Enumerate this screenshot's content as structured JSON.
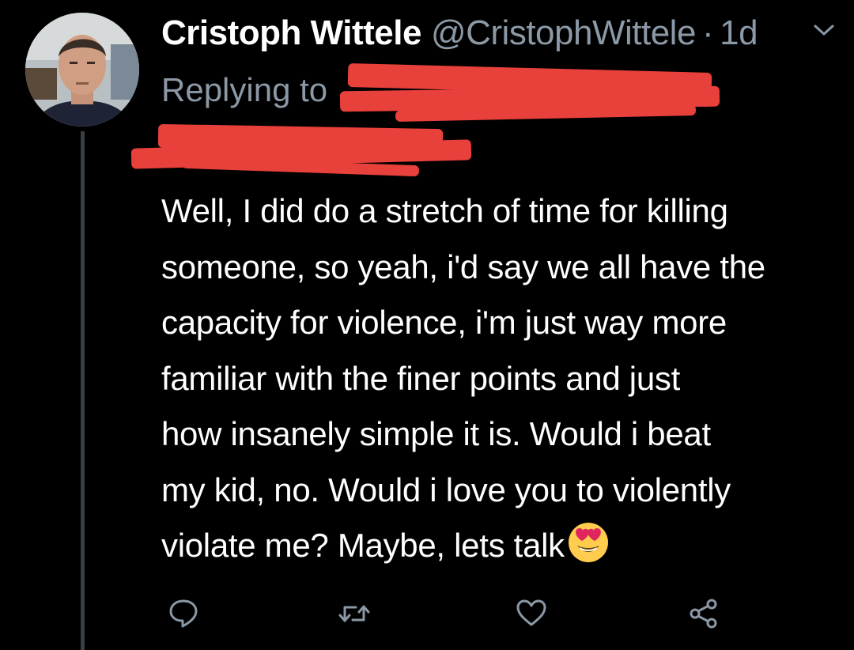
{
  "tweet": {
    "author": {
      "display_name": "Cristoph Wittele",
      "handle": "@CristophWittele",
      "separator": "·",
      "time": "1d"
    },
    "reply": {
      "prefix": "Replying to"
    },
    "body_lines": [
      "Well, I did do a stretch of time for killing",
      "someone, so yeah, i'd say we all have the",
      "capacity for violence, i'm just way more",
      "familiar with the finer points and just",
      "how insanely simple it is. Would i beat",
      "my kid, no. Would i love you to violently",
      "violate me? Maybe, lets talk"
    ],
    "emoji": "smiling-face-with-heart-eyes",
    "actions": [
      "reply-icon",
      "retweet-icon",
      "like-icon",
      "share-icon"
    ]
  },
  "colors": {
    "background": "#000000",
    "text": "#ffffff",
    "muted": "#8b98a5",
    "redaction": "#e8403a",
    "thread_line": "#3a3f44"
  }
}
